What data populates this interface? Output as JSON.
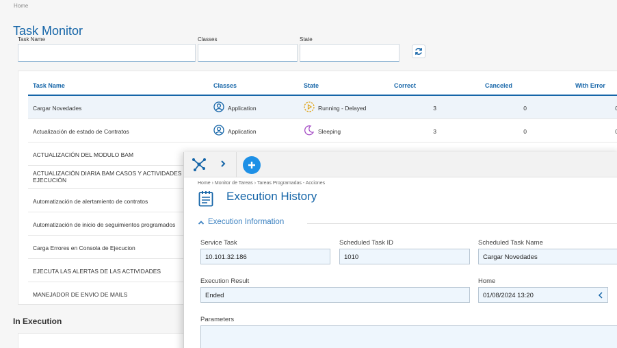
{
  "breadcrumb": "Home",
  "page_title": "Task Monitor",
  "filters": {
    "task_name_label": "Task Name",
    "classes_label": "Classes",
    "state_label": "State"
  },
  "grid": {
    "headers": {
      "task_name": "Task Name",
      "classes": "Classes",
      "state": "State",
      "correct": "Correct",
      "canceled": "Canceled",
      "with_error": "With Error"
    },
    "rows": [
      {
        "name": "Cargar Novedades",
        "class": "Application",
        "state": "Running - Delayed",
        "correct": "3",
        "canceled": "0",
        "error": "0"
      },
      {
        "name": "Actualización de estado de Contratos",
        "class": "Application",
        "state": "Sleeping",
        "correct": "3",
        "canceled": "0",
        "error": "0"
      },
      {
        "name": "ACTUALIZACIÓN DEL MODULO BAM"
      },
      {
        "name": "ACTUALIZACIÓN DIARIA BAM CASOS Y ACTIVIDADES EN EJECUCIÓN"
      },
      {
        "name": "Automatización de alertamiento de contratos"
      },
      {
        "name": "Automatización de inicio de seguimientos programados"
      },
      {
        "name": "Carga Errores en Consola de Ejecucion"
      },
      {
        "name": "EJECUTA LAS ALERTAS DE LAS ACTIVIDADES"
      },
      {
        "name": "MANEJADOR DE ENVIO DE MAILS"
      }
    ]
  },
  "in_execution_title": "In Execution",
  "overlay": {
    "breadcrumb": "Home › Monitor de Tareas › Tareas Programadas - Acciones",
    "title": "Execution History",
    "section_title": "Execution Information",
    "fields": {
      "service_task_label": "Service Task",
      "service_task_value": "10.101.32.186",
      "scheduled_task_id_label": "Scheduled Task ID",
      "scheduled_task_id_value": "1010",
      "scheduled_task_name_label": "Scheduled Task Name",
      "scheduled_task_name_value": "Cargar Novedades",
      "execution_result_label": "Execution Result",
      "execution_result_value": "Ended",
      "home_label": "Home",
      "home_value": "01/08/2024 13:20",
      "parameters_label": "Parameters"
    }
  },
  "colors": {
    "brand_blue": "#1565a8",
    "accent_blue": "#1e90e6",
    "running_icon": "#e0a419",
    "sleeping_icon": "#a64fc6"
  }
}
